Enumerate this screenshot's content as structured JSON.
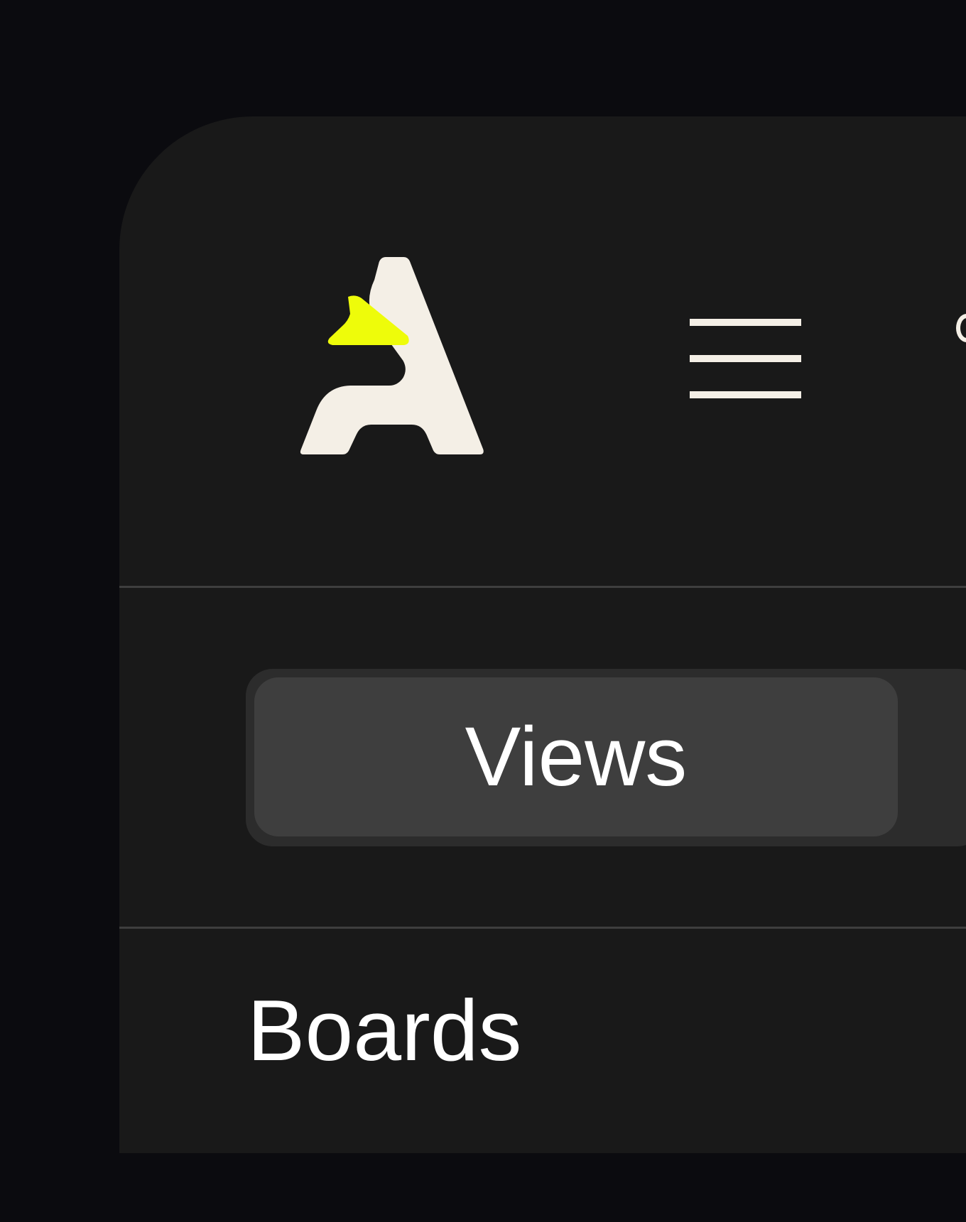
{
  "brand": {
    "logo_icon": "a-logo-icon",
    "colors": {
      "page_background": "#0b0b0f",
      "panel_background": "#191919",
      "logo_primary": "#f4efe6",
      "logo_accent": "#eefc0a",
      "divider": "#3e3e3e",
      "segment_track": "#2c2c2c",
      "segment_active": "#3e3e3e",
      "text": "#ffffff"
    }
  },
  "header": {
    "menu_icon": "hamburger-menu-icon"
  },
  "segmented_control": {
    "active_label": "Views"
  },
  "nav": {
    "boards_label": "Boards"
  }
}
